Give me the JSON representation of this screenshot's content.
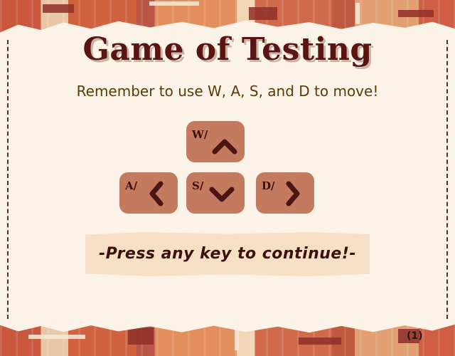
{
  "title": "Game of Testing",
  "instruction": "Remember to use W, A, S, and D to move!",
  "keys": {
    "w": {
      "label": "W/",
      "icon": "chevron-up-icon"
    },
    "a": {
      "label": "A/",
      "icon": "chevron-left-icon"
    },
    "s": {
      "label": "S/",
      "icon": "chevron-down-icon"
    },
    "d": {
      "label": "D/",
      "icon": "chevron-right-icon"
    }
  },
  "prompt": "-Press any key to continue!-",
  "page_number": "(1)",
  "colors": {
    "paper": "#fbf3e7",
    "title": "#5b1414",
    "key_fill": "#c47a5f",
    "arrow": "#4a1512",
    "instruction_text": "#5a3a08",
    "banner": "#f6dfc4"
  }
}
